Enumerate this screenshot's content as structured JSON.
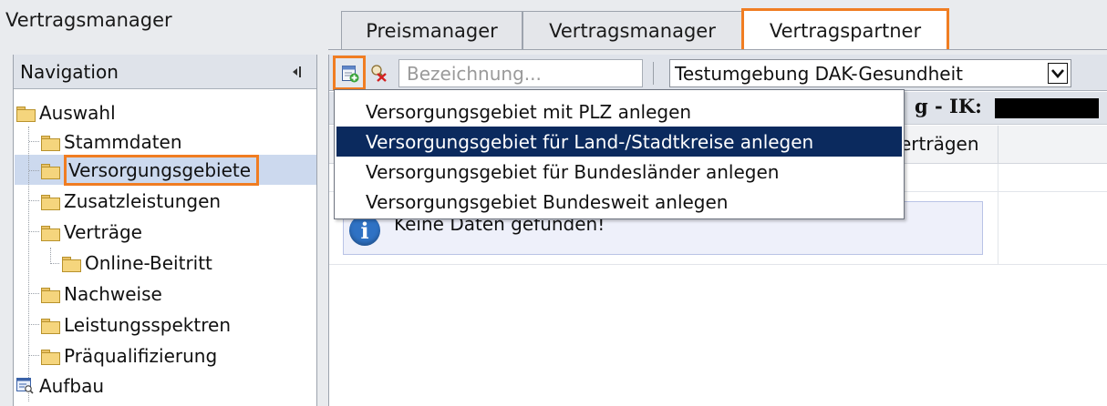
{
  "app": {
    "title": "Vertragsmanager"
  },
  "tabs": [
    {
      "label": "Preismanager"
    },
    {
      "label": "Vertragsmanager"
    },
    {
      "label": "Vertragspartner"
    }
  ],
  "navigation": {
    "title": "Navigation",
    "items": [
      {
        "label": "Auswahl"
      },
      {
        "label": "Stammdaten"
      },
      {
        "label": "Versorgungsgebiete"
      },
      {
        "label": "Zusatzleistungen"
      },
      {
        "label": "Verträge"
      },
      {
        "label": "Online-Beitritt"
      },
      {
        "label": "Nachweise"
      },
      {
        "label": "Leistungsspektren"
      },
      {
        "label": "Präqualifizierung"
      },
      {
        "label": "Aufbau"
      }
    ]
  },
  "toolbar": {
    "search_placeholder": "Bezeichnung...",
    "environment_selected": "Testumgebung DAK-Gesundheit"
  },
  "table": {
    "title_fragment": "g - IK:",
    "column_fragment": "erträgen",
    "empty_message": "Keine Daten gefunden!"
  },
  "add_menu": {
    "items": [
      {
        "label": "Versorgungsgebiet mit PLZ anlegen"
      },
      {
        "label": "Versorgungsgebiet für Land-/Stadtkreise anlegen"
      },
      {
        "label": "Versorgungsgebiet für Bundesländer anlegen"
      },
      {
        "label": "Versorgungsgebiet Bundesweit anlegen"
      }
    ]
  },
  "colors": {
    "highlight_border": "#f07d22",
    "menu_selected": "#0b2a5e",
    "tree_selected": "#ccd9ee",
    "header_bg": "#dfe3ea"
  }
}
